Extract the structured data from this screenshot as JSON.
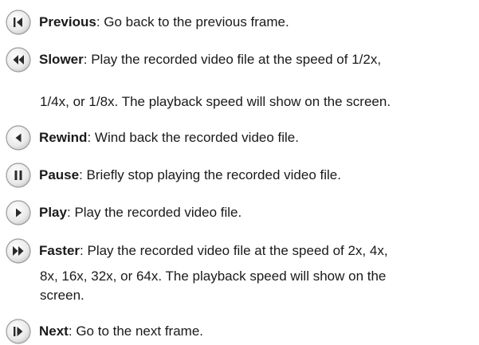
{
  "controls": [
    {
      "id": "previous",
      "name": "Previous",
      "sep": ":",
      "desc": " Go back to the previous frame."
    },
    {
      "id": "slower",
      "name": "Slower",
      "sep": ":",
      "desc": " Play the recorded video file at the speed of 1/2x,",
      "cont": [
        "1/4x, or 1/8x. The playback speed will show on the screen."
      ]
    },
    {
      "id": "rewind",
      "name": "Rewind",
      "sep": ":",
      "desc": " Wind back the recorded video file."
    },
    {
      "id": "pause",
      "name": "Pause",
      "sep": ":",
      "desc": " Briefly stop playing the recorded video file."
    },
    {
      "id": "play",
      "name": "Play",
      "sep": ":",
      "desc": " Play the recorded video file."
    },
    {
      "id": "faster",
      "name": "Faster",
      "sep": ":",
      "desc": " Play the recorded video file at the speed of 2x, 4x,",
      "cont": [
        "8x, 16x, 32x, or 64x. The playback speed will show on the",
        "screen."
      ]
    },
    {
      "id": "next",
      "name": "Next",
      "sep": ":",
      "desc": " Go to the next frame."
    }
  ]
}
